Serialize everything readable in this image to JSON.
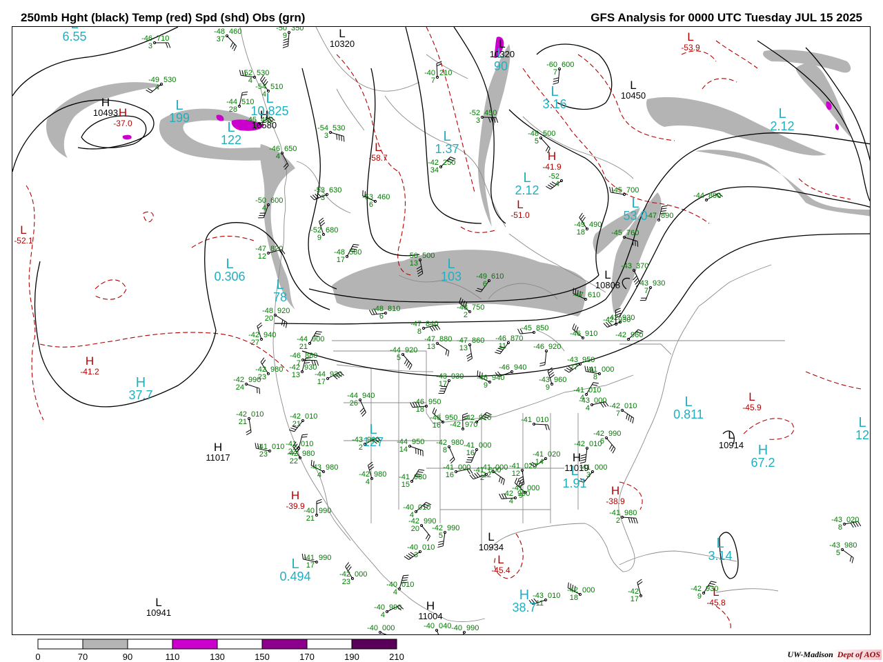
{
  "header": {
    "left_title": "250mb Hght (black) Temp (red) Spd (shd) Obs (grn)",
    "right_title": "GFS Analysis for 0000 UTC Tuesday  JUL 15 2025"
  },
  "colors": {
    "height_contour": "#000000",
    "temperature": "#b40000",
    "observations": "#007a00",
    "wind_label": "#1fb0c0",
    "speed_70_90": "#b4b4b4",
    "speed_110_130": "#cc00cc",
    "speed_150_170": "#8c008c",
    "speed_190_210": "#5a005a",
    "map_lines": "#888888"
  },
  "legend": {
    "labels": [
      "0",
      "70",
      "90",
      "110",
      "130",
      "150",
      "170",
      "190",
      "210"
    ],
    "fills": [
      "#ffffff",
      "#b4b4b4",
      "#ffffff",
      "#cc00cc",
      "#ffffff",
      "#8c008c",
      "#ffffff",
      "#5a005a"
    ]
  },
  "credit": {
    "org": "UW-Madison",
    "dept": "Dept of AOS"
  },
  "pressure_centers": [
    {
      "kind": "height",
      "letter": "H",
      "value": "10493"
    },
    {
      "kind": "height",
      "letter": "H",
      "value": "10580"
    },
    {
      "kind": "height",
      "letter": "H",
      "value": "11017"
    },
    {
      "kind": "height",
      "letter": "H",
      "value": "11019"
    },
    {
      "kind": "height",
      "letter": "L",
      "value": "10941"
    },
    {
      "kind": "height",
      "letter": "H",
      "value": "11004"
    },
    {
      "kind": "height",
      "letter": "L",
      "value": "10934"
    },
    {
      "kind": "height",
      "letter": "L",
      "value": "10914"
    },
    {
      "kind": "height",
      "letter": "L",
      "value": "10320"
    },
    {
      "kind": "height",
      "letter": "L",
      "value": "10320"
    },
    {
      "kind": "height",
      "letter": "L",
      "value": "10808"
    },
    {
      "kind": "height",
      "letter": "L",
      "value": "10450"
    },
    {
      "kind": "temp",
      "letter": "H",
      "value": "-37.0"
    },
    {
      "kind": "temp",
      "letter": "H",
      "value": "-41.2"
    },
    {
      "kind": "temp",
      "letter": "H",
      "value": "-39.9"
    },
    {
      "kind": "temp",
      "letter": "H",
      "value": "-38.9"
    },
    {
      "kind": "temp",
      "letter": "H",
      "value": "-41.9"
    },
    {
      "kind": "temp",
      "letter": "L",
      "value": "-52.1"
    },
    {
      "kind": "temp",
      "letter": "L",
      "value": "-51.0"
    },
    {
      "kind": "temp",
      "letter": "L",
      "value": "-53.9"
    },
    {
      "kind": "temp",
      "letter": "L",
      "value": "-58.7"
    },
    {
      "kind": "temp",
      "letter": "L",
      "value": "-45.4"
    },
    {
      "kind": "temp",
      "letter": "L",
      "value": "-45.9"
    },
    {
      "kind": "temp",
      "letter": "L",
      "value": "-45.8"
    },
    {
      "kind": "wind",
      "letter": "L",
      "value": "6.55"
    },
    {
      "kind": "wind",
      "letter": "L",
      "value": "199"
    },
    {
      "kind": "wind",
      "letter": "L",
      "value": "10.825"
    },
    {
      "kind": "wind",
      "letter": "L",
      "value": "122"
    },
    {
      "kind": "wind",
      "letter": "L",
      "value": "0.306"
    },
    {
      "kind": "wind",
      "letter": "L",
      "value": "78"
    },
    {
      "kind": "wind",
      "letter": "L",
      "value": "1.37"
    },
    {
      "kind": "wind",
      "letter": "L",
      "value": "2.12"
    },
    {
      "kind": "wind",
      "letter": "L",
      "value": "3.16"
    },
    {
      "kind": "wind",
      "letter": "L",
      "value": "2.12"
    },
    {
      "kind": "wind",
      "letter": "L",
      "value": "90"
    },
    {
      "kind": "wind",
      "letter": "L",
      "value": "103"
    },
    {
      "kind": "wind",
      "letter": "L",
      "value": "53.0"
    },
    {
      "kind": "wind",
      "letter": "H",
      "value": "37.7"
    },
    {
      "kind": "wind",
      "letter": "L",
      "value": "127"
    },
    {
      "kind": "wind",
      "letter": "L",
      "value": "1.91"
    },
    {
      "kind": "wind",
      "letter": "L",
      "value": "0.811"
    },
    {
      "kind": "wind",
      "letter": "H",
      "value": "67.2"
    },
    {
      "kind": "wind",
      "letter": "L",
      "value": "0.494"
    },
    {
      "kind": "wind",
      "letter": "H",
      "value": "38.7"
    },
    {
      "kind": "wind",
      "letter": "L",
      "value": "3.14"
    },
    {
      "kind": "wind",
      "letter": "L",
      "value": "12"
    }
  ],
  "stations": [
    {
      "t": "-46",
      "h": "710",
      "dp": "3"
    },
    {
      "t": "-48",
      "h": "460",
      "dp": "37"
    },
    {
      "t": "-50",
      "h": "350",
      "dp": "9"
    },
    {
      "t": "-49",
      "h": "530",
      "dp": "4"
    },
    {
      "t": "-52",
      "h": "530",
      "dp": "4"
    },
    {
      "t": "-54",
      "h": "510",
      "dp": "4"
    },
    {
      "t": "-44",
      "h": "510",
      "dp": "28"
    },
    {
      "t": "-45",
      "h": "450",
      "dp": "3"
    },
    {
      "t": "-54",
      "h": "530",
      "dp": "3"
    },
    {
      "t": "-46",
      "h": "650",
      "dp": "4"
    },
    {
      "t": "-50",
      "h": "600",
      "dp": "4"
    },
    {
      "t": "-53",
      "h": "630",
      "dp": "3"
    },
    {
      "t": "-53",
      "h": "460",
      "dp": "6"
    },
    {
      "t": "-52",
      "h": "680",
      "dp": "9"
    },
    {
      "t": "-48",
      "h": "580",
      "dp": "17"
    },
    {
      "t": "-47",
      "h": "820",
      "dp": "12"
    },
    {
      "t": "-48",
      "h": "920",
      "dp": "20"
    },
    {
      "t": "-50",
      "h": "500",
      "dp": "13"
    },
    {
      "t": "-49",
      "h": "610",
      "dp": "6"
    },
    {
      "t": "-48",
      "h": "810",
      "dp": "6"
    },
    {
      "t": "-48",
      "h": "750",
      "dp": "2"
    },
    {
      "t": "-40",
      "h": "210",
      "dp": "7"
    },
    {
      "t": "-42",
      "h": "250",
      "dp": "34"
    },
    {
      "t": "-52",
      "h": "450",
      "dp": "3"
    },
    {
      "t": "-48",
      "h": "500",
      "dp": "5"
    },
    {
      "t": "-60",
      "h": "600",
      "dp": "7"
    },
    {
      "t": "-52",
      "h": "",
      "dp": "4"
    },
    {
      "t": "-45",
      "h": "700",
      "dp": ""
    },
    {
      "t": "-49",
      "h": "490",
      "dp": "18"
    },
    {
      "t": "-47",
      "h": "890",
      "dp": ""
    },
    {
      "t": "-44",
      "h": "890",
      "dp": ""
    },
    {
      "t": "-45",
      "h": "760",
      "dp": ""
    },
    {
      "t": "-43",
      "h": "370",
      "dp": ""
    },
    {
      "t": "-43",
      "h": "930",
      "dp": "7"
    },
    {
      "t": "-42",
      "h": "930",
      "dp": ""
    },
    {
      "t": "-47",
      "h": "610",
      "dp": ""
    },
    {
      "t": "-42",
      "h": "940",
      "dp": "27"
    },
    {
      "t": "-44",
      "h": "900",
      "dp": "21"
    },
    {
      "t": "-47",
      "h": "840",
      "dp": "8"
    },
    {
      "t": "-47",
      "h": "880",
      "dp": "13"
    },
    {
      "t": "-47",
      "h": "860",
      "dp": "13"
    },
    {
      "t": "-46",
      "h": "870",
      "dp": "11"
    },
    {
      "t": "-45",
      "h": "850",
      "dp": ""
    },
    {
      "t": "-46",
      "h": "910",
      "dp": ""
    },
    {
      "t": "-42",
      "h": "930",
      "dp": ""
    },
    {
      "t": "-42",
      "h": "960",
      "dp": ""
    },
    {
      "t": "-46",
      "h": "880",
      "dp": "7"
    },
    {
      "t": "-44",
      "h": "920",
      "dp": "5"
    },
    {
      "t": "-46",
      "h": "920",
      "dp": ""
    },
    {
      "t": "-43",
      "h": "950",
      "dp": "27"
    },
    {
      "t": "-41",
      "h": "000",
      "dp": "8"
    },
    {
      "t": "-42",
      "h": "980",
      "dp": "23"
    },
    {
      "t": "-42",
      "h": "930",
      "dp": "13"
    },
    {
      "t": "-44",
      "h": "930",
      "dp": "17"
    },
    {
      "t": "-42",
      "h": "990",
      "dp": "24"
    },
    {
      "t": "-44",
      "h": "940",
      "dp": "26"
    },
    {
      "t": "-43",
      "h": "930",
      "dp": "17"
    },
    {
      "t": "-46",
      "h": "940",
      "dp": ""
    },
    {
      "t": "-46",
      "h": "940",
      "dp": "9"
    },
    {
      "t": "-43",
      "h": "960",
      "dp": "9"
    },
    {
      "t": "-41",
      "h": "010",
      "dp": "4"
    },
    {
      "t": "-43",
      "h": "000",
      "dp": "4"
    },
    {
      "t": "-42",
      "h": "010",
      "dp": "7"
    },
    {
      "t": "-42",
      "h": "010",
      "dp": "21"
    },
    {
      "t": "-42",
      "h": "010",
      "dp": "21"
    },
    {
      "t": "-46",
      "h": "950",
      "dp": "18"
    },
    {
      "t": "-46",
      "h": "950",
      "dp": "16"
    },
    {
      "t": "-42",
      "h": "970",
      "dp": ""
    },
    {
      "t": "-42",
      "h": "970",
      "dp": ""
    },
    {
      "t": "-41",
      "h": "010",
      "dp": ""
    },
    {
      "t": "-42",
      "h": "990",
      "dp": "6"
    },
    {
      "t": "-42",
      "h": "010",
      "dp": ""
    },
    {
      "t": "-41",
      "h": "020",
      "dp": "14"
    },
    {
      "t": "-41",
      "h": "010",
      "dp": "23"
    },
    {
      "t": "-42",
      "h": "980",
      "dp": "22"
    },
    {
      "t": "-41",
      "h": "010",
      "dp": "22"
    },
    {
      "t": "-43",
      "h": "960",
      "dp": "2"
    },
    {
      "t": "-44",
      "h": "950",
      "dp": "14"
    },
    {
      "t": "-42",
      "h": "980",
      "dp": "8"
    },
    {
      "t": "-41",
      "h": "000",
      "dp": "16"
    },
    {
      "t": "-41",
      "h": "000",
      "dp": "2"
    },
    {
      "t": "-43",
      "h": "980",
      "dp": "4"
    },
    {
      "t": "-42",
      "h": "980",
      "dp": "4"
    },
    {
      "t": "-41",
      "h": "980",
      "dp": "15"
    },
    {
      "t": "-41",
      "h": "000",
      "dp": "16"
    },
    {
      "t": "-41",
      "h": "000",
      "dp": "12"
    },
    {
      "t": "-41",
      "h": "020",
      "dp": "12"
    },
    {
      "t": "-41",
      "h": "000",
      "dp": "3"
    },
    {
      "t": "-42",
      "h": "990",
      "dp": "4"
    },
    {
      "t": "-41",
      "h": "000",
      "dp": "9"
    },
    {
      "t": "-40",
      "h": "990",
      "dp": "21"
    },
    {
      "t": "-40",
      "h": "010",
      "dp": "4"
    },
    {
      "t": "-41",
      "h": "980",
      "dp": "2"
    },
    {
      "t": "-42",
      "h": "990",
      "dp": "20"
    },
    {
      "t": "-42",
      "h": "990",
      "dp": "5"
    },
    {
      "t": "-40",
      "h": "010",
      "dp": "3"
    },
    {
      "t": "-41",
      "h": "990",
      "dp": "17"
    },
    {
      "t": "-42",
      "h": "000",
      "dp": "23"
    },
    {
      "t": "-40",
      "h": "010",
      "dp": "4"
    },
    {
      "t": "-40",
      "h": "990",
      "dp": "4"
    },
    {
      "t": "-40",
      "h": "000",
      "dp": ""
    },
    {
      "t": "-40",
      "h": "040",
      "dp": ""
    },
    {
      "t": "-40",
      "h": "990",
      "dp": ""
    },
    {
      "t": "-43",
      "h": "010",
      "dp": "11"
    },
    {
      "t": "-42",
      "h": "000",
      "dp": "18"
    },
    {
      "t": "-42",
      "h": "",
      "dp": "17"
    },
    {
      "t": "-42",
      "h": "930",
      "dp": "9"
    },
    {
      "t": "-43",
      "h": "020",
      "dp": "8"
    },
    {
      "t": "-43",
      "h": "980",
      "dp": "5"
    }
  ]
}
